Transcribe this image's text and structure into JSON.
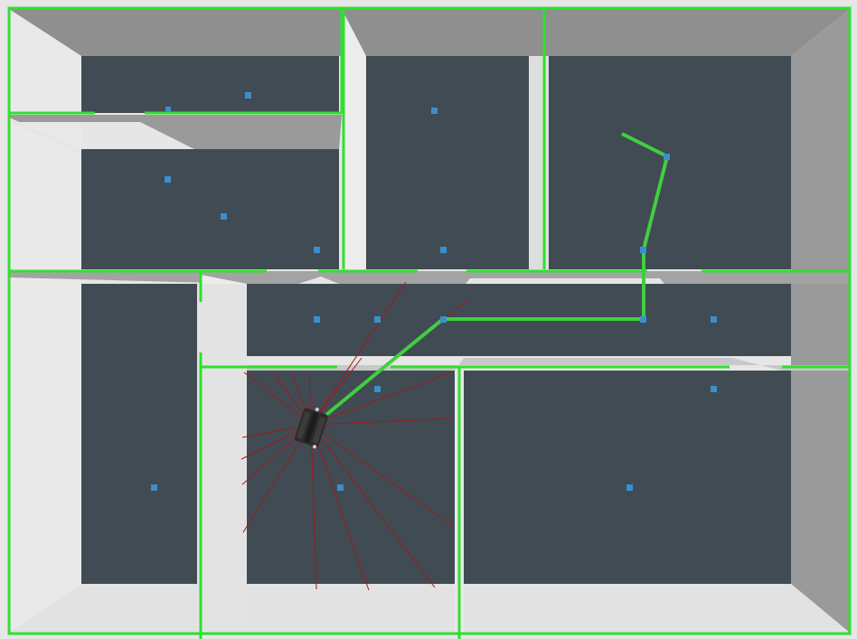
{
  "scene": {
    "colors": {
      "background": "#e6e6e6",
      "wall_shade": "#8f8f8f",
      "wall_light": "#cfcfcf",
      "floor": "#414b53",
      "grid_line": "#2fe02f",
      "waypoint": "#3a8fd0",
      "path": "#3fcf3f",
      "laser": "#9e1b1b",
      "robot": "#2b2b2b"
    }
  }
}
